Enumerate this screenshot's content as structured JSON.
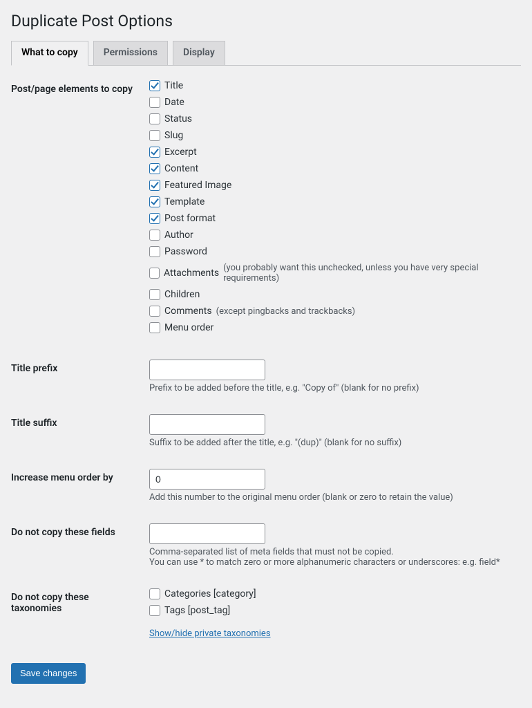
{
  "page": {
    "title": "Duplicate Post Options"
  },
  "tabs": {
    "what_to_copy": "What to copy",
    "permissions": "Permissions",
    "display": "Display"
  },
  "rows": {
    "elements_label": "Post/page elements to copy",
    "title_prefix_label": "Title prefix",
    "title_prefix_hint": "Prefix to be added before the title, e.g. \"Copy of\" (blank for no prefix)",
    "title_suffix_label": "Title suffix",
    "title_suffix_hint": "Suffix to be added after the title, e.g. \"(dup)\" (blank for no suffix)",
    "menu_order_label": "Increase menu order by",
    "menu_order_value": "0",
    "menu_order_hint": "Add this number to the original menu order (blank or zero to retain the value)",
    "no_copy_fields_label": "Do not copy these fields",
    "no_copy_fields_hint1": "Comma-separated list of meta fields that must not be copied.",
    "no_copy_fields_hint2": "You can use * to match zero or more alphanumeric characters or underscores: e.g. field*",
    "no_copy_tax_label": "Do not copy these taxonomies",
    "tax_show_hide": "Show/hide private taxonomies"
  },
  "elements": {
    "title": {
      "label": "Title",
      "checked": true
    },
    "date": {
      "label": "Date",
      "checked": false
    },
    "status": {
      "label": "Status",
      "checked": false
    },
    "slug": {
      "label": "Slug",
      "checked": false
    },
    "excerpt": {
      "label": "Excerpt",
      "checked": true
    },
    "content": {
      "label": "Content",
      "checked": true
    },
    "featured": {
      "label": "Featured Image",
      "checked": true
    },
    "template": {
      "label": "Template",
      "checked": true
    },
    "postformat": {
      "label": "Post format",
      "checked": true
    },
    "author": {
      "label": "Author",
      "checked": false
    },
    "password": {
      "label": "Password",
      "checked": false
    },
    "attachments": {
      "label": "Attachments",
      "checked": false,
      "hint": "(you probably want this unchecked, unless you have very special requirements)"
    },
    "children": {
      "label": "Children",
      "checked": false
    },
    "comments": {
      "label": "Comments",
      "checked": false,
      "hint": "(except pingbacks and trackbacks)"
    },
    "menuorder": {
      "label": "Menu order",
      "checked": false
    }
  },
  "taxonomies": {
    "categories": {
      "label": "Categories [category]",
      "checked": false
    },
    "tags": {
      "label": "Tags [post_tag]",
      "checked": false
    }
  },
  "submit": {
    "label": "Save changes"
  }
}
